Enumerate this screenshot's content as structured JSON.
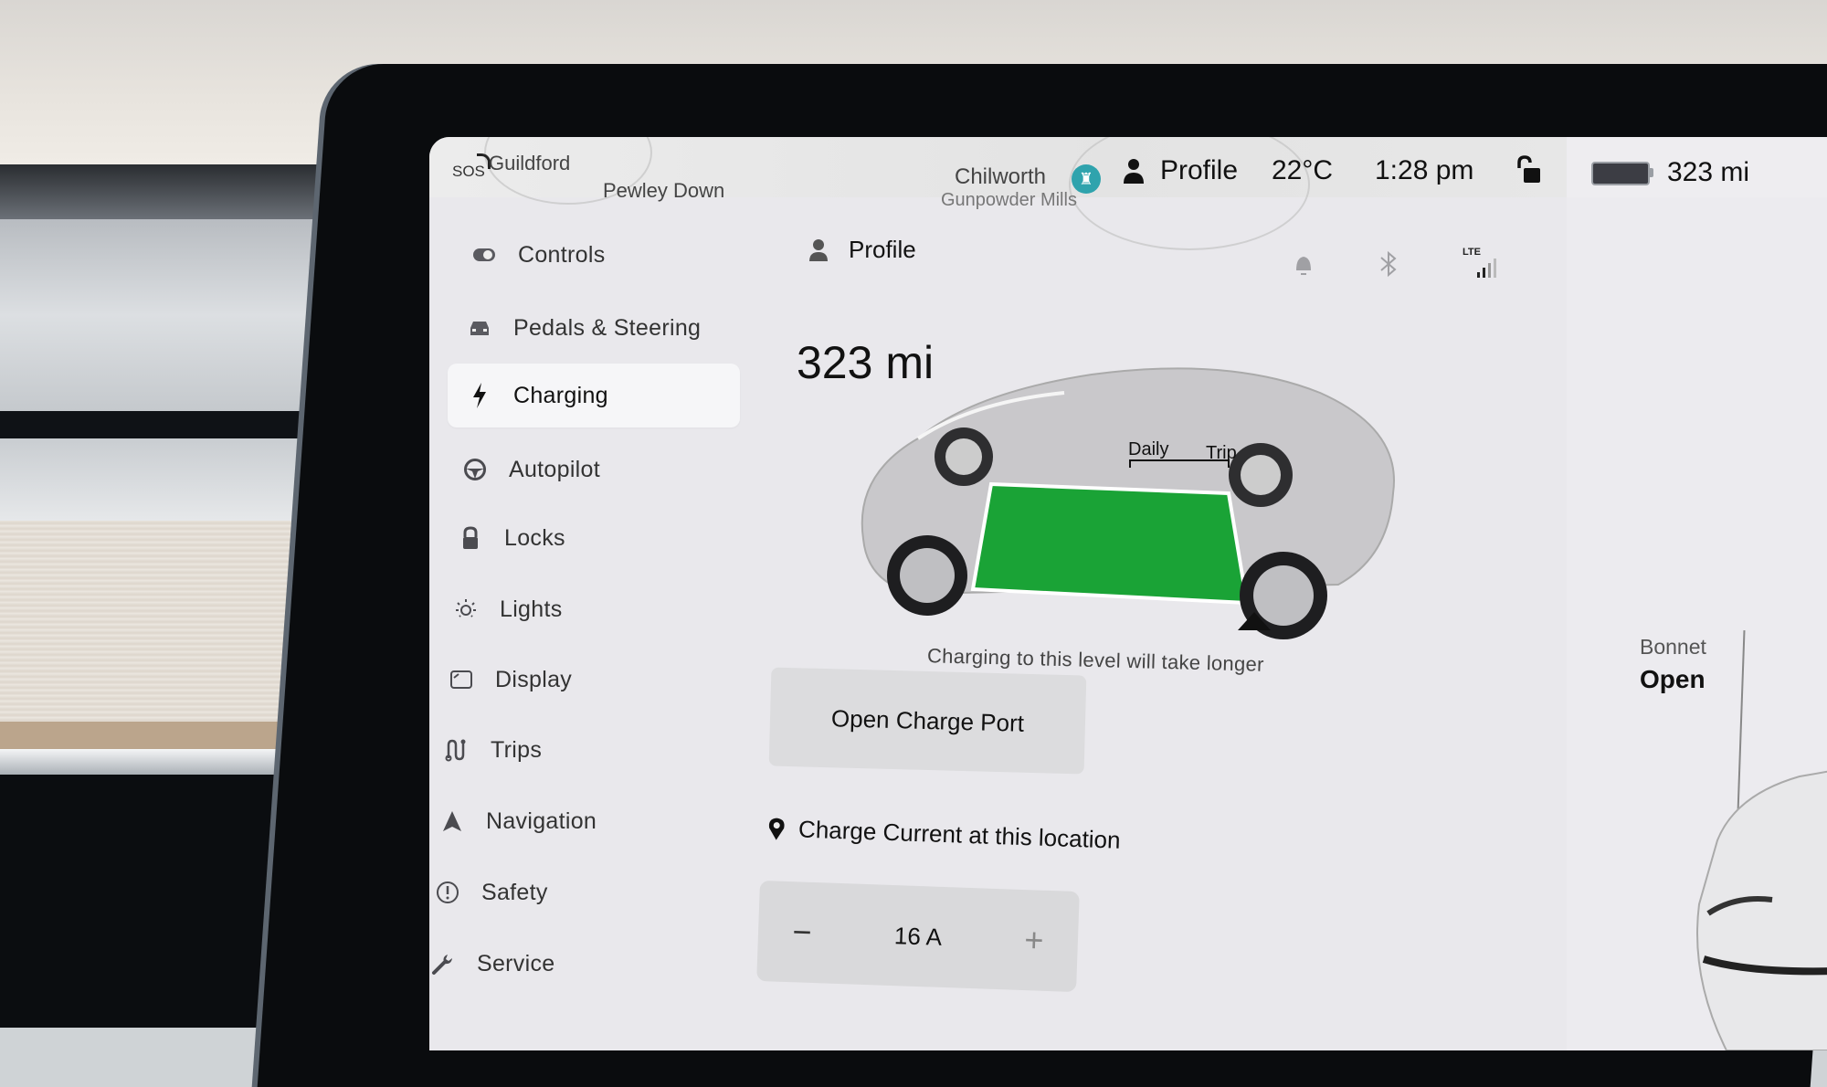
{
  "topbar": {
    "sos": "SOS",
    "map_places": [
      "Guildford",
      "Pewley Down",
      "Chilworth",
      "Gunpowder Mills"
    ],
    "profile_label": "Profile",
    "temperature": "22°C",
    "time": "1:28 pm",
    "lock_state": "unlocked",
    "battery_range": "323 mi"
  },
  "sidebar": {
    "items": [
      {
        "label": "Controls",
        "icon": "toggle-icon",
        "active": false
      },
      {
        "label": "Pedals & Steering",
        "icon": "car-icon",
        "active": false
      },
      {
        "label": "Charging",
        "icon": "lightning-icon",
        "active": true
      },
      {
        "label": "Autopilot",
        "icon": "steering-wheel-icon",
        "active": false
      },
      {
        "label": "Locks",
        "icon": "lock-icon",
        "active": false
      },
      {
        "label": "Lights",
        "icon": "bulb-icon",
        "active": false
      },
      {
        "label": "Display",
        "icon": "display-icon",
        "active": false
      },
      {
        "label": "Trips",
        "icon": "trips-icon",
        "active": false
      },
      {
        "label": "Navigation",
        "icon": "navigation-arrow-icon",
        "active": false
      },
      {
        "label": "Safety",
        "icon": "alert-circle-icon",
        "active": false
      },
      {
        "label": "Service",
        "icon": "wrench-icon",
        "active": false
      }
    ]
  },
  "main": {
    "profile_label": "Profile",
    "status_icons": {
      "notification": "bell-icon",
      "bluetooth": "bluetooth-icon",
      "network": "LTE"
    },
    "range": "323 mi",
    "charge_limit_labels": {
      "daily": "Daily",
      "trip": "Trip"
    },
    "battery_fill_color": "#1aa336",
    "level_note": "Charging to this level will take longer",
    "open_charge_port_label": "Open Charge Port",
    "charge_current": {
      "title": "Charge Current at this location",
      "value": "16 A",
      "decrement": "−",
      "increment": "+"
    }
  },
  "right_panel": {
    "bonnet_label": "Bonnet",
    "bonnet_state": "Open"
  }
}
